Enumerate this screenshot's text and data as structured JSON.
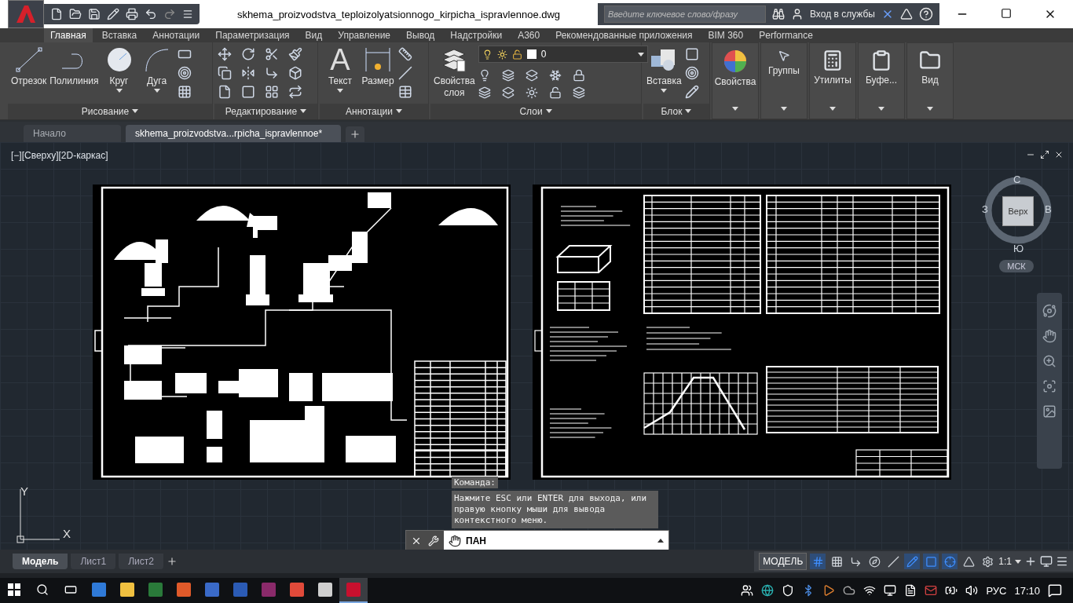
{
  "window": {
    "title": "skhema_proizvodstva_teploizolyatsionnogo_kirpicha_ispravlennoe.dwg",
    "search": {
      "placeholder": "Введите ключевое слово/фразу"
    },
    "sign_in": "Вход в службы"
  },
  "ribbon_tabs": [
    {
      "label": "Главная",
      "selected": true
    },
    {
      "label": "Вставка",
      "selected": false
    },
    {
      "label": "Аннотации",
      "selected": false
    },
    {
      "label": "Параметризация",
      "selected": false
    },
    {
      "label": "Вид",
      "selected": false
    },
    {
      "label": "Управление",
      "selected": false
    },
    {
      "label": "Вывод",
      "selected": false
    },
    {
      "label": "Надстройки",
      "selected": false
    },
    {
      "label": "A360",
      "selected": false
    },
    {
      "label": "Рекомендованные приложения",
      "selected": false
    },
    {
      "label": "BIM 360",
      "selected": false
    },
    {
      "label": "Performance",
      "selected": false
    }
  ],
  "ribbon_panels": [
    {
      "title": "Рисование",
      "tools": [
        {
          "label": "Отрезок",
          "menu": false
        },
        {
          "label": "Полилиния",
          "menu": false
        },
        {
          "label": "Круг",
          "menu": true
        },
        {
          "label": "Дуга",
          "menu": true
        }
      ]
    },
    {
      "title": "Редактирование"
    },
    {
      "title": "Аннотации",
      "tools": [
        {
          "label": "Текст",
          "glyph": "A",
          "menu": true
        },
        {
          "label": "Размер",
          "menu": false
        }
      ]
    },
    {
      "title": "Слои",
      "tools": [
        {
          "label": "Свойства слоя",
          "menu": false
        }
      ],
      "layer": "0"
    },
    {
      "title": "Блок",
      "tools": [
        {
          "label": "Вставка",
          "menu": true
        }
      ]
    }
  ],
  "mini_panels": [
    {
      "label": "Свойства"
    },
    {
      "label": "Группы"
    },
    {
      "label": "Утилиты"
    },
    {
      "label": "Буфе..."
    },
    {
      "label": "Вид"
    }
  ],
  "file_tabs": [
    {
      "label": "Начало",
      "selected": false
    },
    {
      "label": "skhema_proizvodstva...rpicha_ispravlennoe*",
      "selected": true
    }
  ],
  "viewport": {
    "view_label": "[−][Сверху][2D-каркас]",
    "viewcube": {
      "north": "С",
      "west": "З",
      "east": "В",
      "south": "Ю",
      "face": "Верх",
      "ucs": "МСК"
    },
    "ucs_axes": {
      "y": "Y",
      "x": "X"
    }
  },
  "command": {
    "history_label": "Команда:",
    "message": "Нажмите ESC или ENTER для выхода, или правую кнопку мыши для вывода контекстного меню.",
    "input": "ПАН"
  },
  "layout_tabs": [
    {
      "label": "Модель",
      "selected": true
    },
    {
      "label": "Лист1",
      "selected": false
    },
    {
      "label": "Лист2",
      "selected": false
    }
  ],
  "status_bar": {
    "model_button": "МОДЕЛЬ",
    "scale": "1:1",
    "toggles": [
      {
        "on": true
      },
      {
        "on": false
      },
      {
        "on": false
      },
      {
        "on": false
      },
      {
        "on": false
      },
      {
        "on": true
      },
      {
        "on": true
      },
      {
        "on": true
      },
      {
        "on": false
      },
      {
        "on": false
      }
    ]
  },
  "taskbar": {
    "apps": [
      {
        "selected": false
      },
      {
        "selected": false
      },
      {
        "selected": false
      },
      {
        "selected": false
      },
      {
        "selected": false
      },
      {
        "selected": false
      },
      {
        "selected": false
      },
      {
        "selected": false
      },
      {
        "selected": false
      },
      {
        "selected": true
      }
    ],
    "language": "РУС",
    "time": "17:10"
  }
}
